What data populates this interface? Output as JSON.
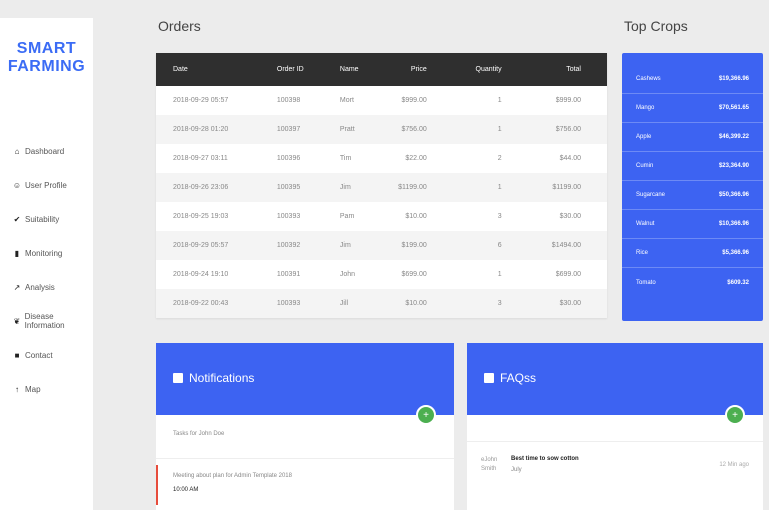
{
  "sidebar": {
    "logo_line1": "SMART",
    "logo_line2": "FARMING",
    "items": [
      {
        "label": "Dashboard",
        "icon": "home-icon",
        "glyph": "⌂"
      },
      {
        "label": "User Profile",
        "icon": "user-icon",
        "glyph": "👤"
      },
      {
        "label": "Suitability",
        "icon": "check-icon",
        "glyph": "✔"
      },
      {
        "label": "Monitoring",
        "icon": "bar-chart-icon",
        "glyph": "▮"
      },
      {
        "label": "Analysis",
        "icon": "line-chart-icon",
        "glyph": "↗"
      },
      {
        "label": "Disease Information",
        "icon": "leaf-icon",
        "glyph": "❦"
      },
      {
        "label": "Contact",
        "icon": "contact-card-icon",
        "glyph": "■"
      },
      {
        "label": "Map",
        "icon": "map-pin-icon",
        "glyph": "↑"
      }
    ]
  },
  "orders": {
    "title": "Orders",
    "columns": [
      "Date",
      "Order ID",
      "Name",
      "Price",
      "Quantity",
      "Total"
    ],
    "rows": [
      [
        "2018-09-29 05:57",
        "100398",
        "Mort",
        "$999.00",
        "1",
        "$999.00"
      ],
      [
        "2018-09-28 01:20",
        "100397",
        "Pratt",
        "$756.00",
        "1",
        "$756.00"
      ],
      [
        "2018-09-27 03:11",
        "100396",
        "Tim",
        "$22.00",
        "2",
        "$44.00"
      ],
      [
        "2018-09-26 23:06",
        "100395",
        "Jim",
        "$1199.00",
        "1",
        "$1199.00"
      ],
      [
        "2018-09-25 19:03",
        "100393",
        "Pam",
        "$10.00",
        "3",
        "$30.00"
      ],
      [
        "2018-09-29 05:57",
        "100392",
        "Jim",
        "$199.00",
        "6",
        "$1494.00"
      ],
      [
        "2018-09-24 19:10",
        "100391",
        "John",
        "$699.00",
        "1",
        "$699.00"
      ],
      [
        "2018-09-22 00:43",
        "100393",
        "Jill",
        "$10.00",
        "3",
        "$30.00"
      ]
    ]
  },
  "top_crops": {
    "title": "Top Crops",
    "rows": [
      {
        "name": "Cashews",
        "value": "$19,366.96"
      },
      {
        "name": "Mango",
        "value": "$70,561.65"
      },
      {
        "name": "Apple",
        "value": "$46,399.22"
      },
      {
        "name": "Cumin",
        "value": "$23,364.90"
      },
      {
        "name": "Sugarcane",
        "value": "$50,366.96"
      },
      {
        "name": "Walnut",
        "value": "$10,366.96"
      },
      {
        "name": "Rice",
        "value": "$5,366.96"
      },
      {
        "name": "Tomato",
        "value": "$609.32"
      }
    ]
  },
  "notifications": {
    "title": "Notifications",
    "icon": "notification-icon",
    "subtitle": "Tasks for John Doe",
    "item_text": "Meeting about plan for Admin Template 2018",
    "item_time": "10:00 AM"
  },
  "faqs": {
    "title": "FAQss",
    "icon": "chat-icon",
    "author": "eJohn Smith",
    "question": "Best time to sow cotton",
    "answer": "July",
    "ago": "12 Min ago"
  },
  "colors": {
    "accent": "#3d63f2",
    "table_header": "#2f2f2f",
    "add_button": "#4caf50",
    "notif_marker": "#e74c3c"
  }
}
